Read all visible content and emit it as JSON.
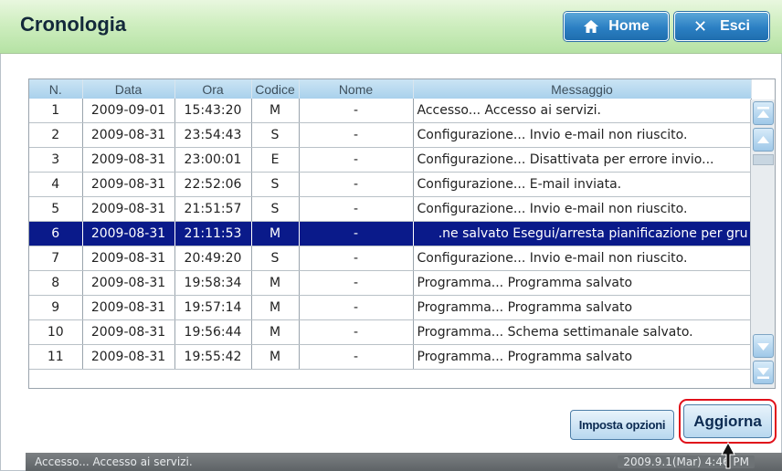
{
  "header": {
    "title": "Cronologia",
    "home_label": "Home",
    "exit_label": "Esci"
  },
  "table": {
    "columns": [
      "N.",
      "Data",
      "Ora",
      "Codice",
      "Nome",
      "Messaggio"
    ],
    "rows": [
      {
        "n": "1",
        "data": "2009-09-01",
        "ora": "15:43:20",
        "codice": "M",
        "nome": "-",
        "msg": "Accesso... Accesso ai servizi."
      },
      {
        "n": "2",
        "data": "2009-08-31",
        "ora": "23:54:43",
        "codice": "S",
        "nome": "-",
        "msg": "Configurazione... Invio e-mail non riuscito."
      },
      {
        "n": "3",
        "data": "2009-08-31",
        "ora": "23:00:01",
        "codice": "E",
        "nome": "-",
        "msg": "Configurazione... Disattivata per errore invio..."
      },
      {
        "n": "4",
        "data": "2009-08-31",
        "ora": "22:52:06",
        "codice": "S",
        "nome": "-",
        "msg": "Configurazione... E-mail inviata."
      },
      {
        "n": "5",
        "data": "2009-08-31",
        "ora": "21:51:57",
        "codice": "S",
        "nome": "-",
        "msg": "Configurazione... Invio e-mail non riuscito."
      },
      {
        "n": "6",
        "data": "2009-08-31",
        "ora": "21:11:53",
        "codice": "M",
        "nome": "-",
        "msg": "ne salvato Esegui/arresta pianificazione per gru."
      },
      {
        "n": "7",
        "data": "2009-08-31",
        "ora": "20:49:20",
        "codice": "S",
        "nome": "-",
        "msg": "Configurazione... Invio e-mail non riuscito."
      },
      {
        "n": "8",
        "data": "2009-08-31",
        "ora": "19:58:34",
        "codice": "M",
        "nome": "-",
        "msg": "Programma... Programma salvato"
      },
      {
        "n": "9",
        "data": "2009-08-31",
        "ora": "19:57:14",
        "codice": "M",
        "nome": "-",
        "msg": "Programma... Programma salvato"
      },
      {
        "n": "10",
        "data": "2009-08-31",
        "ora": "19:56:44",
        "codice": "M",
        "nome": "-",
        "msg": "Programma... Schema settimanale salvato."
      },
      {
        "n": "11",
        "data": "2009-08-31",
        "ora": "19:55:42",
        "codice": "M",
        "nome": "-",
        "msg": "Programma... Programma salvato"
      }
    ]
  },
  "buttons": {
    "options_label": "Imposta opzioni",
    "refresh_label": "Aggiorna"
  },
  "status": {
    "message": "Accesso... Accesso ai servizi.",
    "datetime": "2009.9.1(Mar) 4:46 PM"
  },
  "colors": {
    "header_green": "#c8ebb8",
    "button_blue": "#2b7fc3",
    "selected_row": "#0a1a8a",
    "highlight_red": "#e0101a"
  },
  "icons": {
    "home": "home-icon",
    "exit": "close-icon",
    "scroll_top": "scroll-top-icon",
    "scroll_up": "scroll-up-icon",
    "scroll_down": "scroll-down-icon",
    "scroll_bottom": "scroll-bottom-icon",
    "cursor": "mouse-pointer-icon"
  }
}
